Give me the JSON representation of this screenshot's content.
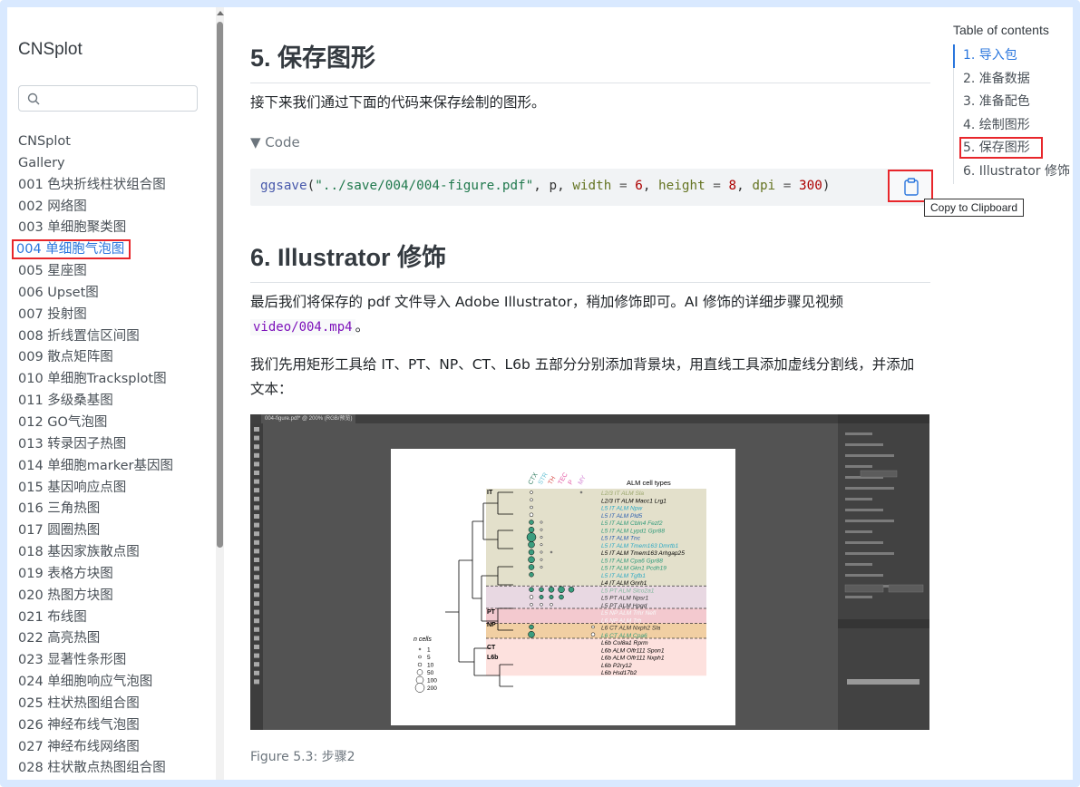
{
  "sidebar": {
    "title": "CNSplot",
    "search_placeholder": "",
    "items": [
      {
        "label": "CNSplot"
      },
      {
        "label": "Gallery"
      },
      {
        "label": "001 色块折线柱状组合图"
      },
      {
        "label": "002 网络图"
      },
      {
        "label": "003 单细胞聚类图"
      },
      {
        "label": "004 单细胞气泡图",
        "active": true
      },
      {
        "label": "005 星座图"
      },
      {
        "label": "006 Upset图"
      },
      {
        "label": "007 投射图"
      },
      {
        "label": "008 折线置信区间图"
      },
      {
        "label": "009 散点矩阵图"
      },
      {
        "label": "010 单细胞Tracksplot图"
      },
      {
        "label": "011 多级桑基图"
      },
      {
        "label": "012 GO气泡图"
      },
      {
        "label": "013 转录因子热图"
      },
      {
        "label": "014 单细胞marker基因图"
      },
      {
        "label": "015 基因响应点图"
      },
      {
        "label": "016 三角热图"
      },
      {
        "label": "017 圆圈热图"
      },
      {
        "label": "018 基因家族散点图"
      },
      {
        "label": "019 表格方块图"
      },
      {
        "label": "020 热图方块图"
      },
      {
        "label": "021 布线图"
      },
      {
        "label": "022 高亮热图"
      },
      {
        "label": "023 显著性条形图"
      },
      {
        "label": "024 单细胞响应气泡图"
      },
      {
        "label": "025 柱状热图组合图"
      },
      {
        "label": "026 神经布线气泡图"
      },
      {
        "label": "027 神经布线网络图"
      },
      {
        "label": "028 柱状散点热图组合图"
      }
    ]
  },
  "main": {
    "section5_title": "5. 保存图形",
    "section5_text": "接下来我们通过下面的代码来保存绘制的图形。",
    "code_toggle": "▼ Code",
    "code": {
      "fn": "ggsave",
      "open": "(",
      "path": "\"../save/004/004-figure.pdf\"",
      "sep1": ", p, ",
      "arg1": "width",
      "eq1": " = ",
      "val1": "6",
      "sep2": ", ",
      "arg2": "height",
      "eq2": " = ",
      "val2": "8",
      "sep3": ", ",
      "arg3": "dpi",
      "eq3": " = ",
      "val3": "300",
      "close": ")"
    },
    "copy_tooltip": "Copy to Clipboard",
    "section6_title": "6. Illustrator 修饰",
    "section6_text_a": "最后我们将保存的 pdf 文件导入 Adobe Illustrator，稍加修饰即可。AI 修饰的详细步骤见视频",
    "video_link": "video/004.mp4",
    "section6_text_a_end": "。",
    "section6_text_b": "我们先用矩形工具给 IT、PT、NP、CT、L6b 五部分分别添加背景块，用直线工具添加虚线分割线，并添加文本：",
    "figure_caption": "Figure 5.3: 步骤2"
  },
  "figure": {
    "tab_title": "004-figure.pdf* @ 200% (RGB/预览)",
    "col_labels": [
      "CTX",
      "STR",
      "TH",
      "TEC",
      "P",
      "MY"
    ],
    "legend_title": "ALM cell types",
    "ncells_title": "n cells",
    "ncells_values": [
      "1",
      "5",
      "10",
      "50",
      "100",
      "200"
    ],
    "group_labels": [
      "IT",
      "PT",
      "NP",
      "CT",
      "L6b"
    ],
    "cell_types": [
      {
        "label": "L2/3 IT ALM Sla",
        "color": "#9aa66c"
      },
      {
        "label": "L2/3 IT ALM Macc1 Lrg1",
        "color": "#000000"
      },
      {
        "label": "L5 IT ALM Npw",
        "color": "#2ba8c4"
      },
      {
        "label": "L5 IT ALM Pld5",
        "color": "#2b5fb0"
      },
      {
        "label": "L5 IT ALM Cbln4 Fezf2",
        "color": "#2f9a7a"
      },
      {
        "label": "L5 IT ALM Lypd1 Gpr88",
        "color": "#2f9a7a"
      },
      {
        "label": "L5 IT ALM Tnc",
        "color": "#2b5fb0"
      },
      {
        "label": "L5 IT ALM Tmem163 Dmrtb1",
        "color": "#2ba8c4"
      },
      {
        "label": "L5 IT ALM Tmem163 Arhgap25",
        "color": "#000000"
      },
      {
        "label": "L5 IT ALM Cpa6 Gpr88",
        "color": "#2f9a7a"
      },
      {
        "label": "L5 IT ALM Gkn1 Pcdh19",
        "color": "#2f9a7a"
      },
      {
        "label": "L5 IT ALM Tgfb1",
        "color": "#2ba8c4"
      },
      {
        "label": "L4 IT ALM Gnrh1",
        "color": "#000000"
      },
      {
        "label": "L5 PT ALM Slco2a1",
        "color": "#7fb89b"
      },
      {
        "label": "L5 PT ALM Npsr1",
        "color": "#333333"
      },
      {
        "label": "L5 PT ALM Hpgd",
        "color": "#333333"
      },
      {
        "label": "L5 NP ALM Trhr Nefl",
        "color": "#ffffff"
      },
      {
        "label": "L6 NP ALM Trh",
        "color": "#ffffff"
      },
      {
        "label": "L6 CT ALM Nxph2 Sla",
        "color": "#333333"
      },
      {
        "label": "L6 CT ALM Cpa6",
        "color": "#2f9a7a"
      },
      {
        "label": "L6b Col8a1 Rprm",
        "color": "#000000"
      },
      {
        "label": "L6b ALM Olfr111 Spon1",
        "color": "#000000"
      },
      {
        "label": "L6b ALM Olfr111 Nxph1",
        "color": "#000000"
      },
      {
        "label": "L6b P2ry12",
        "color": "#000000"
      },
      {
        "label": "L6b Hsd17b2",
        "color": "#000000"
      }
    ]
  },
  "toc": {
    "title": "Table of contents",
    "items": [
      {
        "label": "1. 导入包",
        "active": true
      },
      {
        "label": "2. 准备数据"
      },
      {
        "label": "3. 准备配色"
      },
      {
        "label": "4. 绘制图形"
      },
      {
        "label": "5. 保存图形",
        "boxed": true
      },
      {
        "label": "6. Illustrator 修饰"
      }
    ]
  },
  "colors": {
    "accent": "#2a76dd",
    "highlight_box": "#e8262b",
    "it_band": "#e3e0cb",
    "pt_band": "#e8d8e2",
    "np_band": "#f3c9cf",
    "ct_band": "#f1cfa3",
    "l6b_band": "#fde1de"
  }
}
